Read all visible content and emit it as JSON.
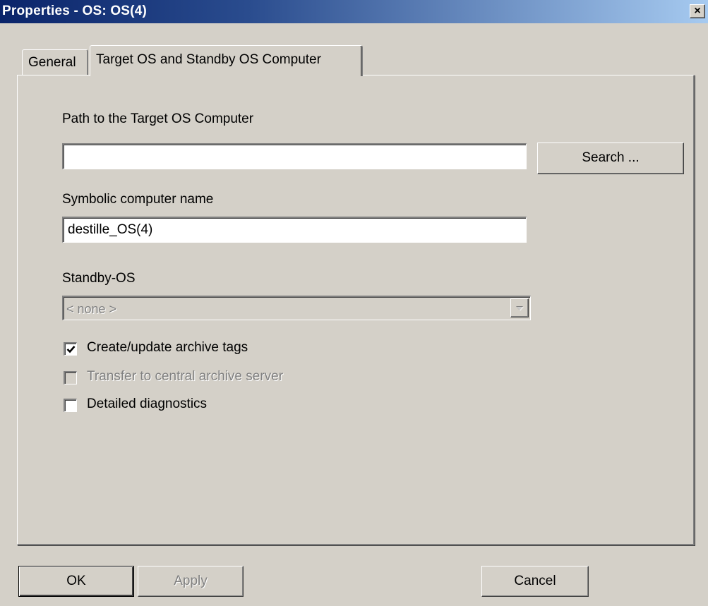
{
  "window": {
    "title": "Properties - OS: OS(4)",
    "close_glyph": "×"
  },
  "tabs": [
    {
      "label": "General",
      "selected": false
    },
    {
      "label": "Target OS and Standby OS Computer",
      "selected": true
    }
  ],
  "target_path": {
    "label": "Path to the Target OS Computer",
    "value": "",
    "search_button": "Search ..."
  },
  "symbolic_name": {
    "label": "Symbolic computer name",
    "value": "destille_OS(4)"
  },
  "standby": {
    "label": "Standby-OS",
    "selected": "< none >",
    "enabled": false,
    "arrow_icon": "chevron-down-icon"
  },
  "checkboxes": [
    {
      "label": "Create/update archive tags",
      "checked": true,
      "enabled": true
    },
    {
      "label": "Transfer to central archive server",
      "checked": false,
      "enabled": false
    },
    {
      "label": "Detailed diagnostics",
      "checked": false,
      "enabled": true
    }
  ],
  "buttons": {
    "ok": "OK",
    "apply": "Apply",
    "cancel": "Cancel"
  },
  "colors": {
    "title_start": "#0a246a",
    "title_end": "#a6caf0",
    "face": "#d4d0c8",
    "disabled_text": "#808080"
  }
}
